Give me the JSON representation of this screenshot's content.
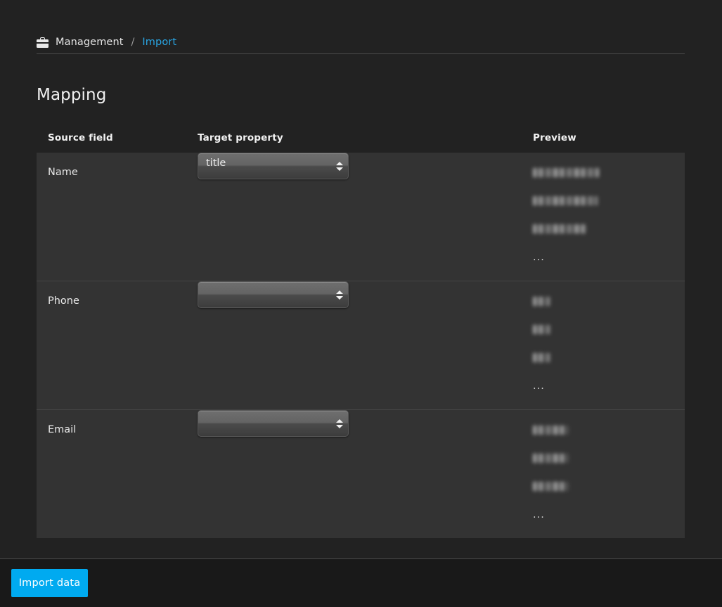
{
  "breadcrumb": {
    "icon": "briefcase-icon",
    "parent_label": "Management",
    "separator": "/",
    "current_label": "Import"
  },
  "page": {
    "title": "Mapping"
  },
  "table": {
    "headers": {
      "source_field": "Source field",
      "target_property": "Target property",
      "preview": "Preview"
    },
    "rows": [
      {
        "source_field": "Name",
        "target_property": "title",
        "preview": {
          "items": [
            "redacted",
            "redacted",
            "redacted"
          ],
          "widths": [
            94,
            92,
            76
          ],
          "more": "..."
        }
      },
      {
        "source_field": "Phone",
        "target_property": "",
        "preview": {
          "items": [
            "redacted",
            "redacted",
            "redacted"
          ],
          "widths": [
            25,
            25,
            25
          ],
          "more": "..."
        }
      },
      {
        "source_field": "Email",
        "target_property": "",
        "preview": {
          "items": [
            "redacted",
            "redacted",
            "redacted"
          ],
          "widths": [
            50,
            50,
            50
          ],
          "more": "..."
        }
      }
    ]
  },
  "footer": {
    "import_button_label": "Import data"
  },
  "colors": {
    "page_background": "#222222",
    "row_background": "#333333",
    "footer_background": "#191919",
    "accent_link": "#29a5e3",
    "primary_button": "#00aaf0",
    "divider": "#4a4a4a",
    "text_primary": "#e8e8e8"
  }
}
